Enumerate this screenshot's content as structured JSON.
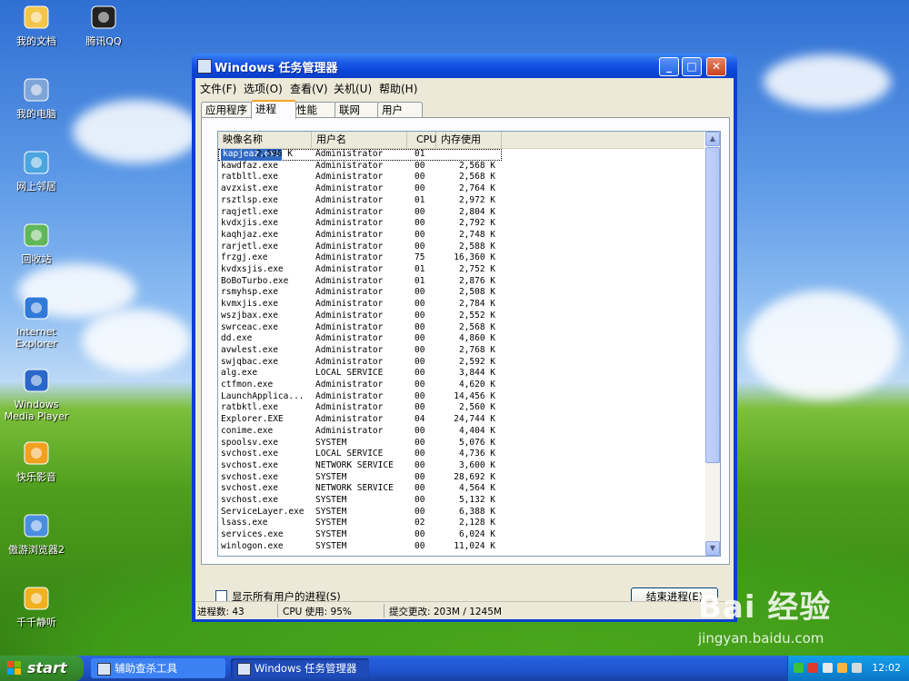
{
  "desktop": {
    "icons": [
      {
        "label": "我的文档",
        "icon": "folder-documents-icon"
      },
      {
        "label": "腾讯QQ",
        "icon": "qq-penguin-icon"
      },
      {
        "label": "我的电脑",
        "icon": "my-computer-icon"
      },
      {
        "label": "网上邻居",
        "icon": "network-neighborhood-icon"
      },
      {
        "label": "回收站",
        "icon": "recycle-bin-icon"
      },
      {
        "label": "Internet Explorer",
        "icon": "internet-explorer-icon"
      },
      {
        "label": "Windows Media Player",
        "icon": "media-player-icon"
      },
      {
        "label": "快乐影音",
        "icon": "media-player-icon"
      },
      {
        "label": "傲游浏览器2",
        "icon": "browser-icon"
      },
      {
        "label": "千千静听",
        "icon": "headphones-icon"
      }
    ]
  },
  "window": {
    "title": "Windows 任务管理器",
    "menu": [
      "文件(F)",
      "选项(O)",
      "查看(V)",
      "关机(U)",
      "帮助(H)"
    ],
    "tabs": [
      "应用程序",
      "进程",
      "性能",
      "联网",
      "用户"
    ],
    "active_tab": "进程",
    "columns": [
      "映像名称",
      "用户名",
      "CPU",
      "内存使用"
    ],
    "processes": [
      {
        "name": "kapjeaz.exe",
        "user": "Administrator",
        "cpu": "01",
        "mem": "2,596 K",
        "selected": true
      },
      {
        "name": "kawdfaz.exe",
        "user": "Administrator",
        "cpu": "00",
        "mem": "2,568 K"
      },
      {
        "name": "ratbltl.exe",
        "user": "Administrator",
        "cpu": "00",
        "mem": "2,568 K"
      },
      {
        "name": "avzxist.exe",
        "user": "Administrator",
        "cpu": "00",
        "mem": "2,764 K"
      },
      {
        "name": "rsztlsp.exe",
        "user": "Administrator",
        "cpu": "01",
        "mem": "2,972 K"
      },
      {
        "name": "raqjetl.exe",
        "user": "Administrator",
        "cpu": "00",
        "mem": "2,804 K"
      },
      {
        "name": "kvdxjis.exe",
        "user": "Administrator",
        "cpu": "00",
        "mem": "2,792 K"
      },
      {
        "name": "kaqhjaz.exe",
        "user": "Administrator",
        "cpu": "00",
        "mem": "2,748 K"
      },
      {
        "name": "rarjetl.exe",
        "user": "Administrator",
        "cpu": "00",
        "mem": "2,588 K"
      },
      {
        "name": "frzgj.exe",
        "user": "Administrator",
        "cpu": "75",
        "mem": "16,360 K"
      },
      {
        "name": "kvdxsjis.exe",
        "user": "Administrator",
        "cpu": "01",
        "mem": "2,752 K"
      },
      {
        "name": "BoBoTurbo.exe",
        "user": "Administrator",
        "cpu": "01",
        "mem": "2,876 K"
      },
      {
        "name": "rsmyhsp.exe",
        "user": "Administrator",
        "cpu": "00",
        "mem": "2,508 K"
      },
      {
        "name": "kvmxjis.exe",
        "user": "Administrator",
        "cpu": "00",
        "mem": "2,784 K"
      },
      {
        "name": "wszjbax.exe",
        "user": "Administrator",
        "cpu": "00",
        "mem": "2,552 K"
      },
      {
        "name": "swrceac.exe",
        "user": "Administrator",
        "cpu": "00",
        "mem": "2,568 K"
      },
      {
        "name": "dd.exe",
        "user": "Administrator",
        "cpu": "00",
        "mem": "4,860 K"
      },
      {
        "name": "avwlest.exe",
        "user": "Administrator",
        "cpu": "00",
        "mem": "2,768 K"
      },
      {
        "name": "swjqbac.exe",
        "user": "Administrator",
        "cpu": "00",
        "mem": "2,592 K"
      },
      {
        "name": "alg.exe",
        "user": "LOCAL SERVICE",
        "cpu": "00",
        "mem": "3,844 K"
      },
      {
        "name": "ctfmon.exe",
        "user": "Administrator",
        "cpu": "00",
        "mem": "4,620 K"
      },
      {
        "name": "LaunchApplica...",
        "user": "Administrator",
        "cpu": "00",
        "mem": "14,456 K"
      },
      {
        "name": "ratbktl.exe",
        "user": "Administrator",
        "cpu": "00",
        "mem": "2,560 K"
      },
      {
        "name": "Explorer.EXE",
        "user": "Administrator",
        "cpu": "04",
        "mem": "24,744 K"
      },
      {
        "name": "conime.exe",
        "user": "Administrator",
        "cpu": "00",
        "mem": "4,404 K"
      },
      {
        "name": "spoolsv.exe",
        "user": "SYSTEM",
        "cpu": "00",
        "mem": "5,076 K"
      },
      {
        "name": "svchost.exe",
        "user": "LOCAL SERVICE",
        "cpu": "00",
        "mem": "4,736 K"
      },
      {
        "name": "svchost.exe",
        "user": "NETWORK SERVICE",
        "cpu": "00",
        "mem": "3,600 K"
      },
      {
        "name": "svchost.exe",
        "user": "SYSTEM",
        "cpu": "00",
        "mem": "28,692 K"
      },
      {
        "name": "svchost.exe",
        "user": "NETWORK SERVICE",
        "cpu": "00",
        "mem": "4,564 K"
      },
      {
        "name": "svchost.exe",
        "user": "SYSTEM",
        "cpu": "00",
        "mem": "5,132 K"
      },
      {
        "name": "ServiceLayer.exe",
        "user": "SYSTEM",
        "cpu": "00",
        "mem": "6,388 K"
      },
      {
        "name": "lsass.exe",
        "user": "SYSTEM",
        "cpu": "02",
        "mem": "2,128 K"
      },
      {
        "name": "services.exe",
        "user": "SYSTEM",
        "cpu": "00",
        "mem": "6,024 K"
      },
      {
        "name": "winlogon.exe",
        "user": "SYSTEM",
        "cpu": "00",
        "mem": "11,024 K"
      }
    ],
    "show_all_users_label": "显示所有用户的进程(S)",
    "end_process_label": "结束进程(E)",
    "status": {
      "processes": "进程数: 43",
      "cpu": "CPU 使用: 95%",
      "commit": "提交更改: 203M / 1245M"
    }
  },
  "taskbar": {
    "start_label": "start",
    "items": [
      "辅助查杀工具",
      "Windows 任务管理器"
    ],
    "clock": "12:02"
  },
  "watermark": {
    "logo": "Bai 经验",
    "url": "jingyan.baidu.com"
  },
  "colors": {
    "titlebar": "#0a46d8",
    "selection": "#316ac5",
    "taskbar": "#245edb",
    "start": "#388e2e"
  }
}
